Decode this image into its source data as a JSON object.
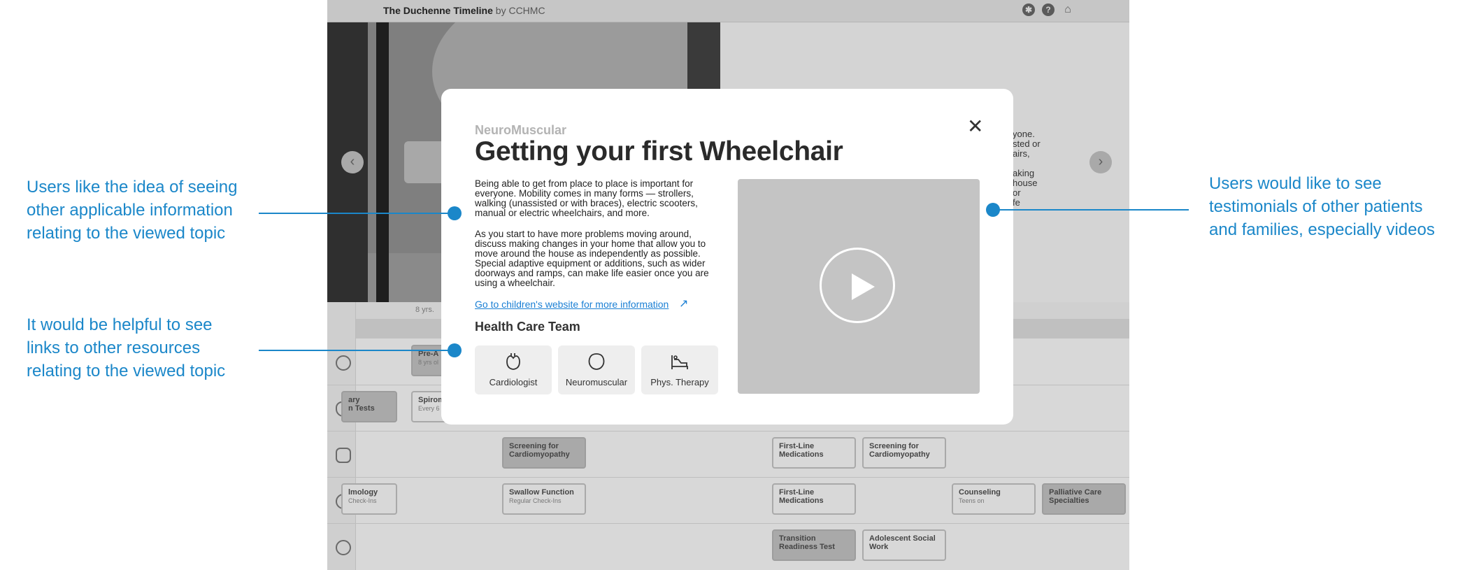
{
  "app": {
    "title": "The Duchenne Timeline",
    "by": "by CCHMC",
    "icons": [
      "gear-icon",
      "help-icon",
      "home-icon"
    ],
    "age_label": "8 yrs.",
    "peek_lines": [
      "yone.",
      "sted or",
      "airs,",
      "",
      "aking",
      "house",
      "or",
      "fe"
    ]
  },
  "timeline": {
    "chips": [
      {
        "title": "Pre-A",
        "sub": "8 yrs ol",
        "dark": true
      },
      {
        "title": "ary",
        "title2": "n Tests",
        "dark": true
      },
      {
        "title": "Spirom",
        "sub": "Every 6",
        "dark": false
      },
      {
        "title": "Screening for",
        "title2": "Cardiomyopathy",
        "dark": true
      },
      {
        "title": "First-Line",
        "title2": "Medications",
        "dark": false
      },
      {
        "title": "Screening for",
        "title2": "Cardiomyopathy",
        "dark": false
      },
      {
        "title": "lmology",
        "sub": "Check-Ins",
        "dark": false
      },
      {
        "title": "Swallow Function",
        "sub": "Regular Check-Ins",
        "dark": false
      },
      {
        "title": "First-Line",
        "title2": "Medications",
        "dark": false
      },
      {
        "title": "Counseling",
        "sub": "Teens on",
        "dark": false
      },
      {
        "title": "Palliative Care",
        "title2": "Specialties",
        "dark": true
      },
      {
        "title": "Transition",
        "title2": "Readiness Test",
        "dark": true
      },
      {
        "title": "Adolescent Social",
        "title2": "Work",
        "dark": false
      }
    ]
  },
  "modal": {
    "category": "NeuroMuscular",
    "title": "Getting your first Wheelchair",
    "paragraph1": "Being able to get from place to place is important for everyone. Mobility comes in many forms — strollers, walking (unassisted or with braces), electric scooters, manual or electric wheelchairs, and more.",
    "paragraph2": "As you start to have more problems moving around, discuss making changes in your home that allow you to move around the house as independently as possible. Special adaptive equipment or additions, such as wider doorways and ramps, can make life easier once you are using a wheelchair.",
    "link": "Go to children's website for more information",
    "team_heading": "Health Care Team",
    "team": [
      {
        "label": "Cardiologist",
        "icon": "heart-icon"
      },
      {
        "label": "Neuromuscular",
        "icon": "brain-icon"
      },
      {
        "label": "Phys. Therapy",
        "icon": "bed-icon"
      }
    ],
    "video_icon": "play-icon"
  },
  "annotations": {
    "left_top": "Users like the idea of seeing other applicable information relating to the viewed topic",
    "left_bottom": "It would be helpful to see links to other resources relating to the viewed topic",
    "right": "Users would like to see testimonials of other patients and families, especially videos"
  },
  "colors": {
    "annotation": "#1b87c9",
    "link": "#1a7fd4",
    "overlay": "#d8d8d8"
  }
}
